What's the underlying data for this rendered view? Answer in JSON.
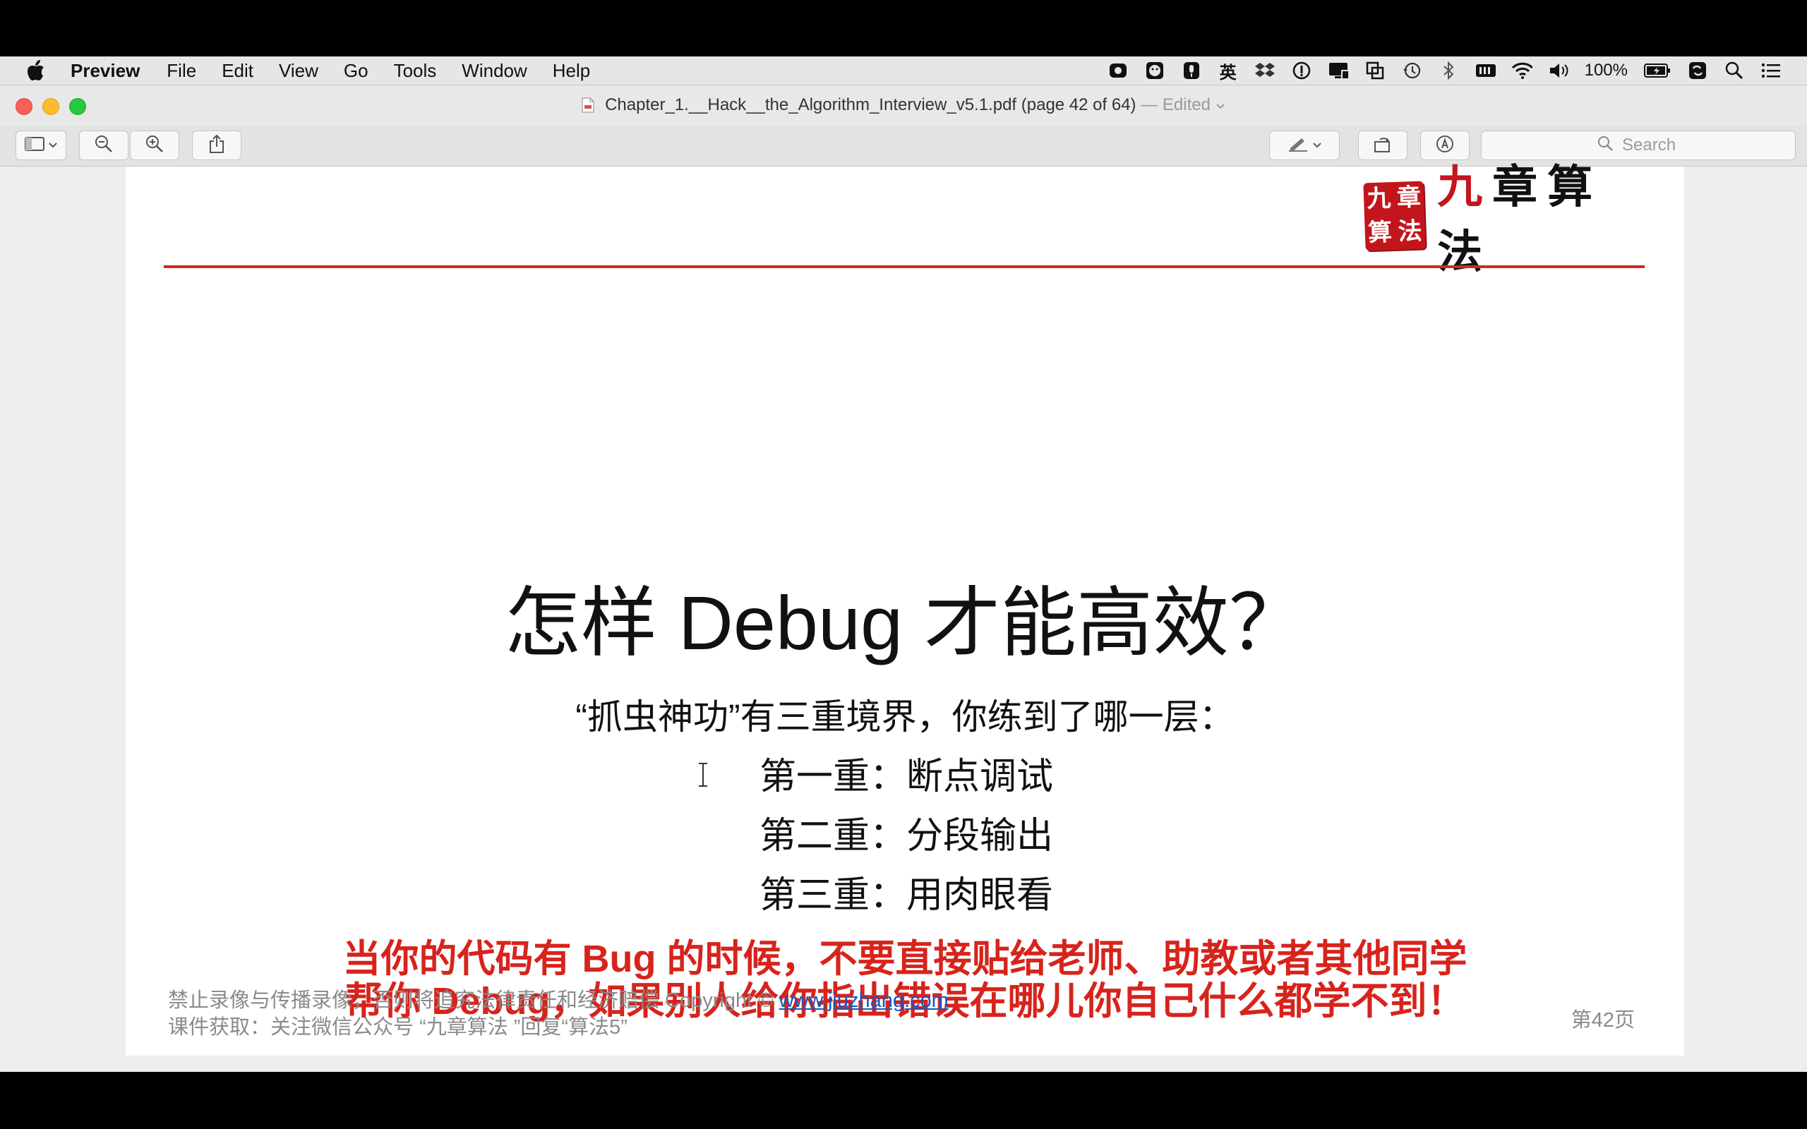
{
  "menubar": {
    "app_name": "Preview",
    "items": [
      "File",
      "Edit",
      "View",
      "Go",
      "Tools",
      "Window",
      "Help"
    ],
    "battery": "100%",
    "icons": [
      "screen-record-icon",
      "face-icon",
      "microphone-icon",
      "input-method-icon",
      "dropbox-icon",
      "info-icon",
      "display-icon",
      "overlap-icon",
      "time-machine-icon",
      "bluetooth-icon",
      "memory-icon",
      "wifi-icon",
      "volume-icon",
      "battery-icon",
      "sync-icon",
      "spotlight-icon",
      "notification-center-icon"
    ],
    "input_method": "英"
  },
  "window": {
    "title": "Chapter_1.__Hack__the_Algorithm_Interview_v5.1.pdf (page 42 of 64)",
    "edited": "— Edited",
    "search_placeholder": "Search"
  },
  "slide": {
    "logo_seal": [
      "九",
      "章",
      "算",
      "法"
    ],
    "logo_text": [
      "九",
      "章算法"
    ],
    "title": "怎样 Debug 才能高效？",
    "intro": "“抓虫神功”有三重境界，你练到了哪一层：",
    "levels": [
      "第一重：断点调试",
      "第二重：分段输出",
      "第三重：用肉眼看"
    ],
    "warning_line1": "当你的代码有 Bug 的时候，不要直接贴给老师、助教或者其他同学",
    "warning_line2": "帮你 Debug，如果别人给你指出错误在哪儿你自己什么都学不到！",
    "footer_line1": "禁止录像与传播录像，否则将追究法律责任和经济赔偿 Copyright © ",
    "footer_link": "www.jiuzhang.com",
    "footer_line2": "课件获取：关注微信公众号 “九章算法 ”回复“算法5”",
    "page_label": "第42页"
  },
  "colors": {
    "accent_red": "#d6241c",
    "rule_red": "#d32722",
    "link_blue": "#1557c0"
  }
}
